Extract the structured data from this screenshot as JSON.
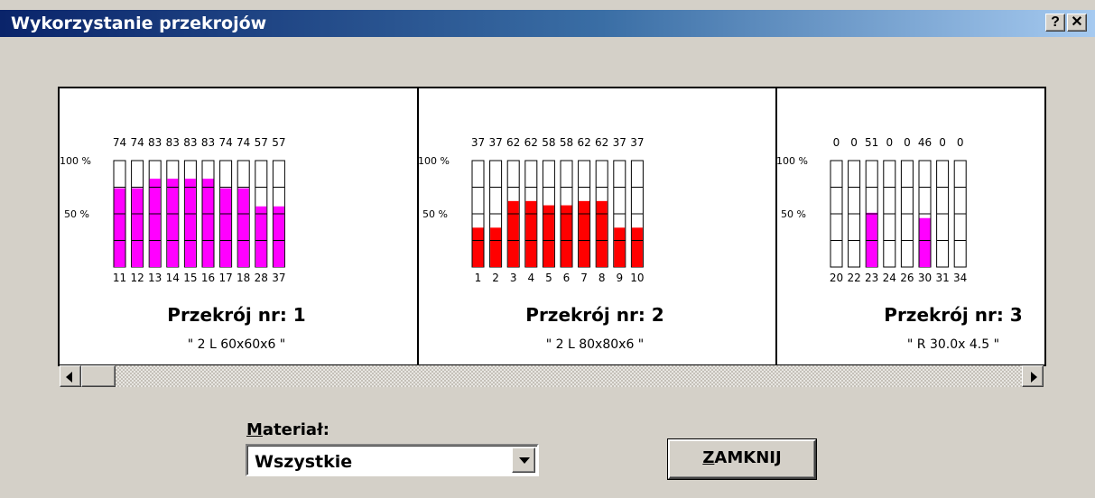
{
  "window": {
    "title": "Wykorzystanie przekrojów",
    "help_label": "?",
    "close_label": "✕"
  },
  "colors": {
    "titlebar_start": "#0a246a",
    "bar_fill_section1": "#ff00ff",
    "bar_fill_section2": "#ff0000",
    "bar_fill_section3": "#ff00ff"
  },
  "chart_data": [
    {
      "type": "bar",
      "title": "Przekrój nr: 1",
      "subtitle": "\" 2 L 60x60x6 \"",
      "ylabels": [
        "100 %",
        "50 %"
      ],
      "ylim": [
        0,
        100
      ],
      "categories": [
        "11",
        "12",
        "13",
        "14",
        "15",
        "16",
        "17",
        "18",
        "28",
        "37"
      ],
      "values": [
        74,
        74,
        83,
        83,
        83,
        83,
        74,
        74,
        57,
        57
      ]
    },
    {
      "type": "bar",
      "title": "Przekrój nr: 2",
      "subtitle": "\" 2 L 80x80x6 \"",
      "ylabels": [
        "100 %",
        "50 %"
      ],
      "ylim": [
        0,
        100
      ],
      "categories": [
        "1",
        "2",
        "3",
        "4",
        "5",
        "6",
        "7",
        "8",
        "9",
        "10"
      ],
      "values": [
        37,
        37,
        62,
        62,
        58,
        58,
        62,
        62,
        37,
        37
      ]
    },
    {
      "type": "bar",
      "title": "Przekrój nr: 3",
      "subtitle": "\" R 30.0x 4.5 \"",
      "ylabels": [
        "100 %",
        "50 %"
      ],
      "ylim": [
        0,
        100
      ],
      "categories": [
        "20",
        "22",
        "23",
        "24",
        "26",
        "30",
        "31",
        "34"
      ],
      "values": [
        0,
        0,
        51,
        0,
        0,
        46,
        0,
        0
      ]
    }
  ],
  "material": {
    "label_accel": "M",
    "label_rest": "ateriał:",
    "selected": "Wszystkie"
  },
  "close_button": {
    "accel": "Z",
    "rest": "AMKNIJ"
  }
}
